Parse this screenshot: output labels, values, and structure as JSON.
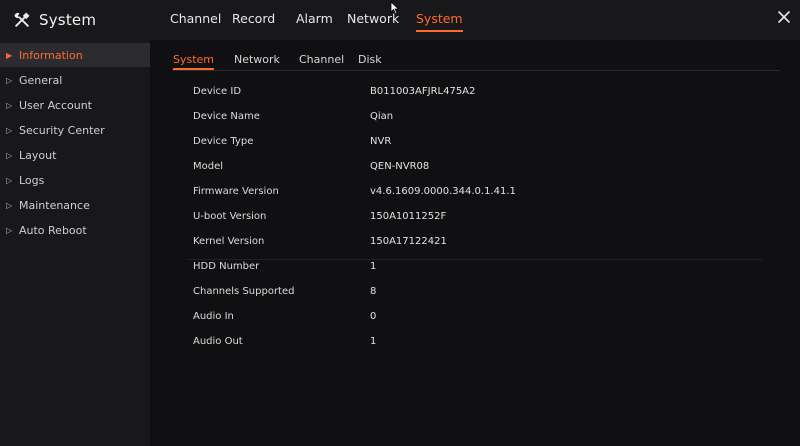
{
  "header": {
    "title": "System",
    "title_icon": "tools-icon",
    "tabs": [
      {
        "label": "Channel"
      },
      {
        "label": "Record"
      },
      {
        "label": "Alarm"
      },
      {
        "label": "Network"
      },
      {
        "label": "System"
      }
    ],
    "active_tab": "System",
    "close_icon": "close-icon"
  },
  "sidebar": {
    "items": [
      {
        "label": "Information"
      },
      {
        "label": "General"
      },
      {
        "label": "User Account"
      },
      {
        "label": "Security Center"
      },
      {
        "label": "Layout"
      },
      {
        "label": "Logs"
      },
      {
        "label": "Maintenance"
      },
      {
        "label": "Auto Reboot"
      }
    ],
    "active_item": "Information"
  },
  "subtabs": {
    "items": [
      {
        "label": "System"
      },
      {
        "label": "Network"
      },
      {
        "label": "Channel"
      },
      {
        "label": "Disk"
      }
    ],
    "active": "System"
  },
  "info": {
    "rows": [
      {
        "label": "Device ID",
        "value": "B011003AFJRL475A2"
      },
      {
        "label": "Device Name",
        "value": "Qian"
      },
      {
        "label": "Device Type",
        "value": "NVR"
      },
      {
        "label": "Model",
        "value": "QEN-NVR08"
      },
      {
        "label": "Firmware Version",
        "value": "v4.6.1609.0000.344.0.1.41.1"
      },
      {
        "label": "U-boot Version",
        "value": "150A1011252F"
      },
      {
        "label": "Kernel Version",
        "value": "150A17122421"
      },
      {
        "label": "HDD Number",
        "value": "1"
      },
      {
        "label": "Channels Supported",
        "value": "8"
      },
      {
        "label": "Audio In",
        "value": "0"
      },
      {
        "label": "Audio Out",
        "value": "1"
      }
    ]
  },
  "colors": {
    "accent": "#ff6a2b",
    "background": "#101012",
    "panel": "#18181b",
    "sidebar_active": "#2c2c30",
    "text": "#e6e6e6"
  }
}
